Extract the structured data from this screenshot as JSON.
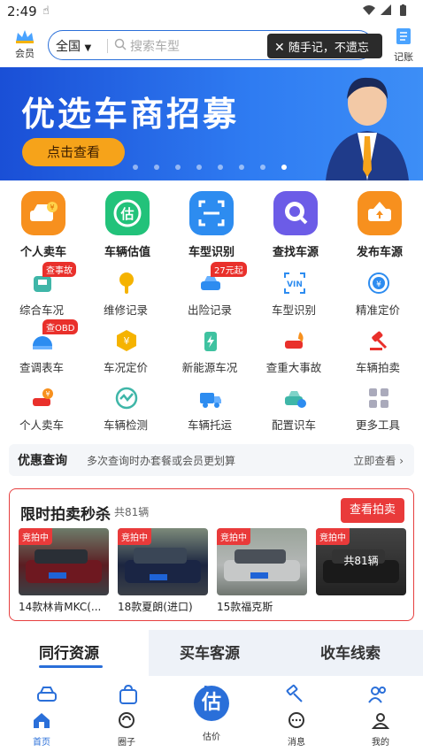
{
  "status": {
    "time": "2:49"
  },
  "header": {
    "vip_label": "会员",
    "city": "全国",
    "search_placeholder": "搜索车型",
    "tooltip": "随手记，不遗忘",
    "ledger_label": "记账"
  },
  "banner": {
    "title": "优选车商招募",
    "button": "点击查看",
    "slide_count": 8,
    "active_slide": 8
  },
  "main_icons": [
    {
      "label": "个人卖车",
      "icon": "car-sell-icon",
      "color": "#f7901e"
    },
    {
      "label": "车辆估值",
      "icon": "valuation-icon",
      "color": "#22c27a"
    },
    {
      "label": "车型识别",
      "icon": "scan-icon",
      "color": "#2d8cf0"
    },
    {
      "label": "查找车源",
      "icon": "search-car-icon",
      "color": "#6c5ce7"
    },
    {
      "label": "发布车源",
      "icon": "publish-icon",
      "color": "#f7901e"
    }
  ],
  "tools_row1": [
    {
      "label": "综合车况",
      "icon": "car-condition-icon",
      "tag": "查事故"
    },
    {
      "label": "维修记录",
      "icon": "wrench-icon",
      "tag": ""
    },
    {
      "label": "出险记录",
      "icon": "insurance-car-icon",
      "tag": "27元起"
    },
    {
      "label": "车型识别",
      "icon": "vin-icon",
      "tag": ""
    },
    {
      "label": "精准定价",
      "icon": "price-target-icon",
      "tag": ""
    }
  ],
  "tools_row2": [
    {
      "label": "查调表车",
      "icon": "odometer-icon",
      "tag": "查OBD"
    },
    {
      "label": "车况定价",
      "icon": "yuan-hex-icon",
      "tag": ""
    },
    {
      "label": "新能源车况",
      "icon": "battery-icon",
      "tag": ""
    },
    {
      "label": "查重大事故",
      "icon": "fire-car-icon",
      "tag": ""
    },
    {
      "label": "车辆拍卖",
      "icon": "gavel-icon",
      "tag": ""
    }
  ],
  "tools_row3": [
    {
      "label": "个人卖车",
      "icon": "car-yuan-icon",
      "tag": ""
    },
    {
      "label": "车辆检测",
      "icon": "inspection-icon",
      "tag": ""
    },
    {
      "label": "车辆托运",
      "icon": "truck-icon",
      "tag": ""
    },
    {
      "label": "配置识车",
      "icon": "config-car-icon",
      "tag": ""
    },
    {
      "label": "更多工具",
      "icon": "grid-icon",
      "tag": ""
    }
  ],
  "promo": {
    "title": "优惠查询",
    "text": "多次查询时办套餐或会员更划算",
    "link": "立即查看"
  },
  "auction": {
    "title": "限时拍卖秒杀",
    "count": "共81辆",
    "button": "查看拍卖",
    "badge": "竞拍中",
    "cars": [
      {
        "name": "14款林肯MKC(...",
        "overlay": ""
      },
      {
        "name": "18款夏朗(进口)",
        "overlay": ""
      },
      {
        "name": "15款福克斯",
        "overlay": ""
      },
      {
        "name": "",
        "overlay": "共81辆"
      }
    ]
  },
  "tabs": [
    {
      "label": "同行资源"
    },
    {
      "label": "买车客源"
    },
    {
      "label": "收车线索"
    }
  ],
  "bottom_nav": [
    {
      "label": "首页",
      "icon": "home-icon"
    },
    {
      "label": "圈子",
      "icon": "circle-icon"
    },
    {
      "label": "估价",
      "icon": "valuation-fab-icon"
    },
    {
      "label": "消息",
      "icon": "message-icon"
    },
    {
      "label": "我的",
      "icon": "profile-icon"
    }
  ],
  "fab_label": "估",
  "colors": {
    "primary": "#2a6fd9",
    "accent_red": "#e93a3a",
    "banner_button": "#f6a31a"
  }
}
